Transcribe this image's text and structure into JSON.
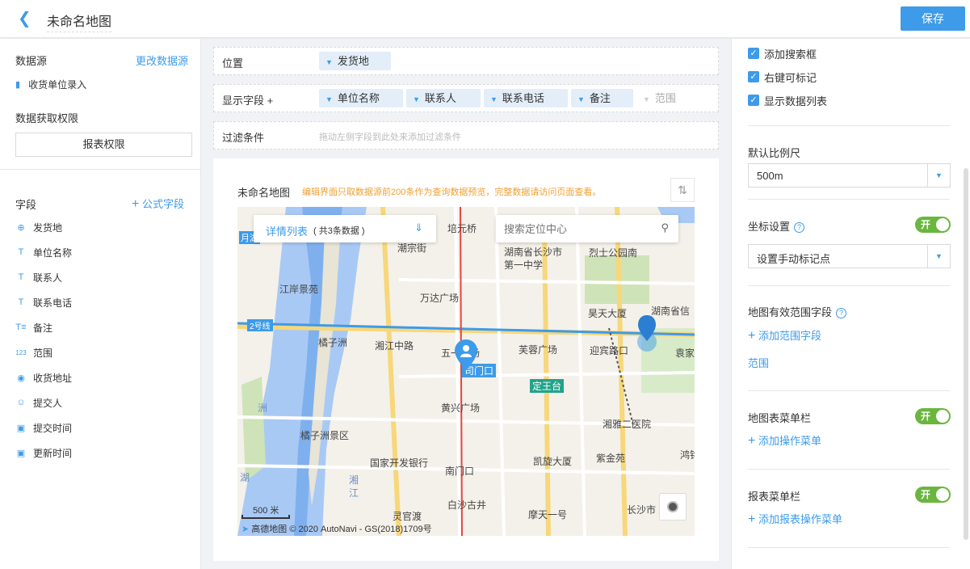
{
  "header": {
    "title": "未命名地图",
    "save_label": "保存"
  },
  "left": {
    "datasource_title": "数据源",
    "change_datasource": "更改数据源",
    "datasource_name": "收货单位录入",
    "permission_title": "数据获取权限",
    "report_permission_button": "报表权限",
    "fields_title": "字段",
    "formula_field": "公式字段",
    "fields": [
      {
        "icon": "⊕",
        "label": "发货地"
      },
      {
        "icon": "T",
        "label": "单位名称"
      },
      {
        "icon": "T",
        "label": "联系人"
      },
      {
        "icon": "T",
        "label": "联系电话"
      },
      {
        "icon": "T≡",
        "label": "备注"
      },
      {
        "icon": "123",
        "label": "范围"
      },
      {
        "icon": "◉",
        "label": "收货地址"
      },
      {
        "icon": "☺",
        "label": "提交人"
      },
      {
        "icon": "▣",
        "label": "提交时间"
      },
      {
        "icon": "▣",
        "label": "更新时间"
      }
    ]
  },
  "center": {
    "position_label": "位置",
    "position_chip": "发货地",
    "display_label": "显示字段 +",
    "display_chips": [
      "单位名称",
      "联系人",
      "联系电话",
      "备注",
      "范围"
    ],
    "filter_label": "过滤条件",
    "filter_hint": "拖动左侧字段到此处来添加过滤条件",
    "card_title": "未命名地图",
    "card_note": "编辑界面只取数据源前200条作为查询数据预览，完整数据请访问页面查看。",
    "detail_list": "详情列表",
    "detail_count": "( 共3条数据 )",
    "search_placeholder": "搜索定位中心",
    "scale": "500 米",
    "attribution": "© 2020 AutoNavi - GS(2018)1709号",
    "map_brand": "高德地图",
    "map_labels": [
      "培元桥",
      "潮宗街",
      "湖南省长沙市第一中学",
      "烈士公园南",
      "江岸景苑",
      "万达广场",
      "昊天大厦",
      "湖南省信",
      "2号线",
      "橘子洲",
      "湘江中路",
      "五一广场",
      "芙蓉广场",
      "迎宾路口",
      "袁家",
      "司门口",
      "定王台",
      "黄兴广场",
      "湘雅二医院",
      "橘子洲景区",
      "国家开发银行",
      "南门口",
      "凯旋大厦",
      "紫金苑",
      "鸿铭",
      "灵官渡",
      "白沙古井",
      "摩天一号",
      "长沙市",
      "湘江",
      "洲",
      "湖",
      "月湖"
    ]
  },
  "right": {
    "checks": [
      "添加搜索框",
      "右键可标记",
      "显示数据列表"
    ],
    "scale_title": "默认比例尺",
    "scale_value": "500m",
    "coord_title": "坐标设置",
    "coord_value": "设置手动标记点",
    "range_title": "地图有效范围字段",
    "add_range": "添加范围字段",
    "range_field": "范围",
    "menu_title": "地图表菜单栏",
    "add_menu": "添加操作菜单",
    "report_menu_title": "报表菜单栏",
    "add_report_menu": "添加报表操作菜单",
    "toggle_on": "开"
  }
}
